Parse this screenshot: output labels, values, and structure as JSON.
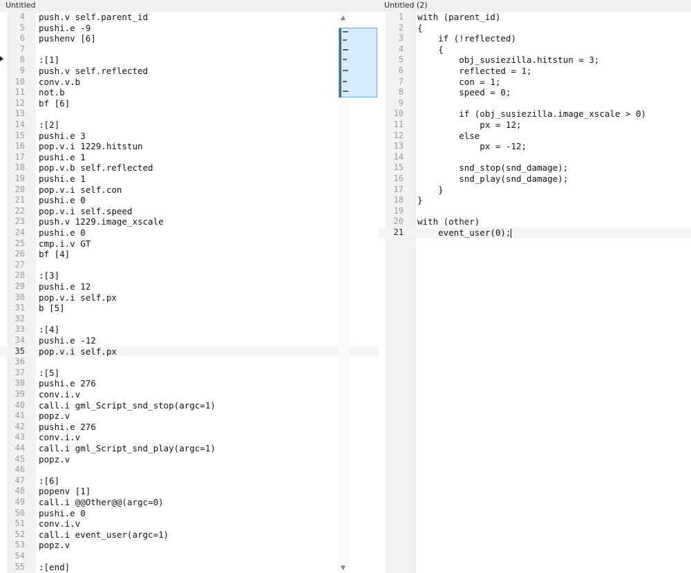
{
  "tabs": {
    "left": "Untitled",
    "right": "Untitled (2)"
  },
  "left_editor": {
    "current_line": "35",
    "lines": [
      {
        "n": "4",
        "text": "push.v self.parent_id"
      },
      {
        "n": "5",
        "text": "pushi.e -9"
      },
      {
        "n": "6",
        "text": "pushenv [6]"
      },
      {
        "n": "7",
        "text": ""
      },
      {
        "n": "8",
        "text": ":[1]"
      },
      {
        "n": "9",
        "text": "push.v self.reflected"
      },
      {
        "n": "10",
        "text": "conv.v.b"
      },
      {
        "n": "11",
        "text": "not.b"
      },
      {
        "n": "12",
        "text": "bf [6]"
      },
      {
        "n": "13",
        "text": ""
      },
      {
        "n": "14",
        "text": ":[2]"
      },
      {
        "n": "15",
        "text": "pushi.e 3"
      },
      {
        "n": "16",
        "text": "pop.v.i 1229.hitstun"
      },
      {
        "n": "17",
        "text": "pushi.e 1"
      },
      {
        "n": "18",
        "text": "pop.v.b self.reflected"
      },
      {
        "n": "19",
        "text": "pushi.e 1"
      },
      {
        "n": "20",
        "text": "pop.v.i self.con"
      },
      {
        "n": "21",
        "text": "pushi.e 0"
      },
      {
        "n": "22",
        "text": "pop.v.i self.speed"
      },
      {
        "n": "23",
        "text": "push.v 1229.image_xscale"
      },
      {
        "n": "24",
        "text": "pushi.e 0"
      },
      {
        "n": "25",
        "text": "cmp.i.v GT"
      },
      {
        "n": "26",
        "text": "bf [4]"
      },
      {
        "n": "27",
        "text": ""
      },
      {
        "n": "28",
        "text": ":[3]"
      },
      {
        "n": "29",
        "text": "pushi.e 12"
      },
      {
        "n": "30",
        "text": "pop.v.i self.px"
      },
      {
        "n": "31",
        "text": "b [5]"
      },
      {
        "n": "32",
        "text": ""
      },
      {
        "n": "33",
        "text": ":[4]"
      },
      {
        "n": "34",
        "text": "pushi.e -12"
      },
      {
        "n": "35",
        "text": "pop.v.i self.px"
      },
      {
        "n": "36",
        "text": ""
      },
      {
        "n": "37",
        "text": ":[5]"
      },
      {
        "n": "38",
        "text": "pushi.e 276"
      },
      {
        "n": "39",
        "text": "conv.i.v"
      },
      {
        "n": "40",
        "text": "call.i gml_Script_snd_stop(argc=1)"
      },
      {
        "n": "41",
        "text": "popz.v"
      },
      {
        "n": "42",
        "text": "pushi.e 276"
      },
      {
        "n": "43",
        "text": "conv.i.v"
      },
      {
        "n": "44",
        "text": "call.i gml_Script_snd_play(argc=1)"
      },
      {
        "n": "45",
        "text": "popz.v"
      },
      {
        "n": "46",
        "text": ""
      },
      {
        "n": "47",
        "text": ":[6]"
      },
      {
        "n": "48",
        "text": "popenv [1]"
      },
      {
        "n": "49",
        "text": "call.i @@Other@@(argc=0)"
      },
      {
        "n": "50",
        "text": "pushi.e 0"
      },
      {
        "n": "51",
        "text": "conv.i.v"
      },
      {
        "n": "52",
        "text": "call.i event_user(argc=1)"
      },
      {
        "n": "53",
        "text": "popz.v"
      },
      {
        "n": "54",
        "text": ""
      },
      {
        "n": "55",
        "text": ":[end]"
      }
    ]
  },
  "right_editor": {
    "current_line": "21",
    "lines": [
      {
        "n": "1",
        "text": "with (parent_id)"
      },
      {
        "n": "2",
        "text": "{"
      },
      {
        "n": "3",
        "text": "    if (!reflected)"
      },
      {
        "n": "4",
        "text": "    {"
      },
      {
        "n": "5",
        "text": "        obj_susiezilla.hitstun = 3;"
      },
      {
        "n": "6",
        "text": "        reflected = 1;"
      },
      {
        "n": "7",
        "text": "        con = 1;"
      },
      {
        "n": "8",
        "text": "        speed = 0;"
      },
      {
        "n": "9",
        "text": ""
      },
      {
        "n": "10",
        "text": "        if (obj_susiezilla.image_xscale > 0)"
      },
      {
        "n": "11",
        "text": "            px = 12;"
      },
      {
        "n": "12",
        "text": "        else"
      },
      {
        "n": "13",
        "text": "            px = -12;"
      },
      {
        "n": "14",
        "text": ""
      },
      {
        "n": "15",
        "text": "        snd_stop(snd_damage);"
      },
      {
        "n": "16",
        "text": "        snd_play(snd_damage);"
      },
      {
        "n": "17",
        "text": "    }"
      },
      {
        "n": "18",
        "text": "}"
      },
      {
        "n": "19",
        "text": ""
      },
      {
        "n": "20",
        "text": "with (other)"
      },
      {
        "n": "21",
        "text": "    event_user(0);"
      }
    ]
  },
  "icons": {
    "scroll_up": "up-arrow-icon",
    "scroll_down": "down-arrow-icon"
  }
}
